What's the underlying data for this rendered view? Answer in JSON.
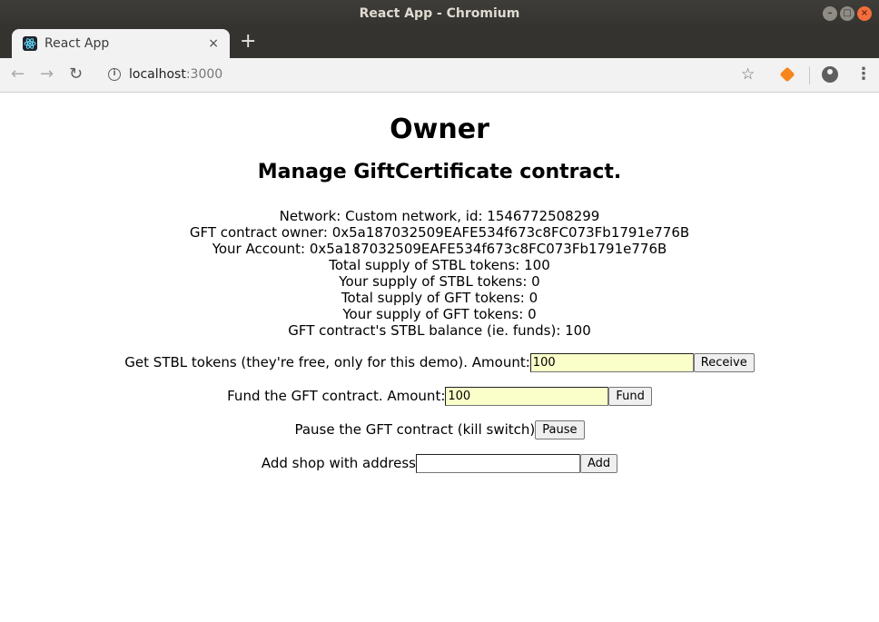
{
  "window": {
    "title": "React App - Chromium",
    "controls": {
      "minimize": "–",
      "maximize": "□",
      "close": "×"
    }
  },
  "tab": {
    "title": "React App",
    "close": "×",
    "favicon_icon": "react-icon"
  },
  "newtab_label": "+",
  "address": {
    "host": "localhost",
    "port": ":3000"
  },
  "page": {
    "title": "Owner",
    "subtitle": "Manage GiftCertificate contract.",
    "info": [
      "Network: Custom network, id: 1546772508299",
      "GFT contract owner: 0x5a187032509EAFE534f673c8FC073Fb1791e776B",
      "Your Account: 0x5a187032509EAFE534f673c8FC073Fb1791e776B",
      "Total supply of STBL tokens: 100",
      "Your supply of STBL tokens: 0",
      "Total supply of GFT tokens: 0",
      "Your supply of GFT tokens: 0",
      "GFT contract's STBL balance (ie. funds): 100"
    ],
    "receive": {
      "label": "Get STBL tokens (they're free, only for this demo). Amount:",
      "value": "100",
      "button": "Receive"
    },
    "fund": {
      "label": "Fund the GFT contract. Amount:",
      "value": "100",
      "button": "Fund"
    },
    "pause": {
      "label": "Pause the GFT contract (kill switch)",
      "button": "Pause"
    },
    "add_shop": {
      "label": "Add shop with address",
      "value": "",
      "button": "Add"
    }
  },
  "colors": {
    "autofill": "#fafec8",
    "titlebar": "#3f3d39",
    "close_button": "#f46d3b"
  }
}
